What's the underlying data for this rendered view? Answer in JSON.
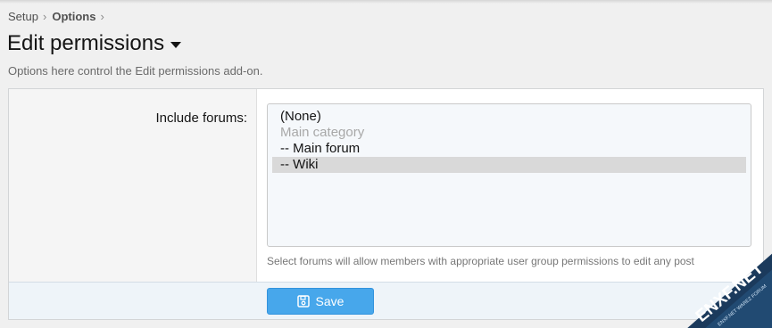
{
  "breadcrumb": {
    "items": [
      "Setup",
      "Options"
    ],
    "separator": "›"
  },
  "page": {
    "title": "Edit permissions",
    "description": "Options here control the Edit permissions add-on."
  },
  "option": {
    "label": "Include forums:",
    "listbox": [
      {
        "label": "(None)",
        "state": "normal"
      },
      {
        "label": "Main category",
        "state": "disabled"
      },
      {
        "label": "-- Main forum",
        "state": "normal"
      },
      {
        "label": "-- Wiki",
        "state": "selected"
      }
    ],
    "hint": "Select forums will allow members with appropriate user group permissions to edit any post"
  },
  "footer": {
    "save_label": "Save",
    "save_icon": "save-icon"
  },
  "watermark": {
    "text": "ENXF.NET",
    "subtext": "ENXF.NET WAREZ FORUM"
  },
  "colors": {
    "accent": "#47a7eb",
    "selected_option_bg": "#d9d9d9",
    "footer_bg": "#eef4f9"
  }
}
